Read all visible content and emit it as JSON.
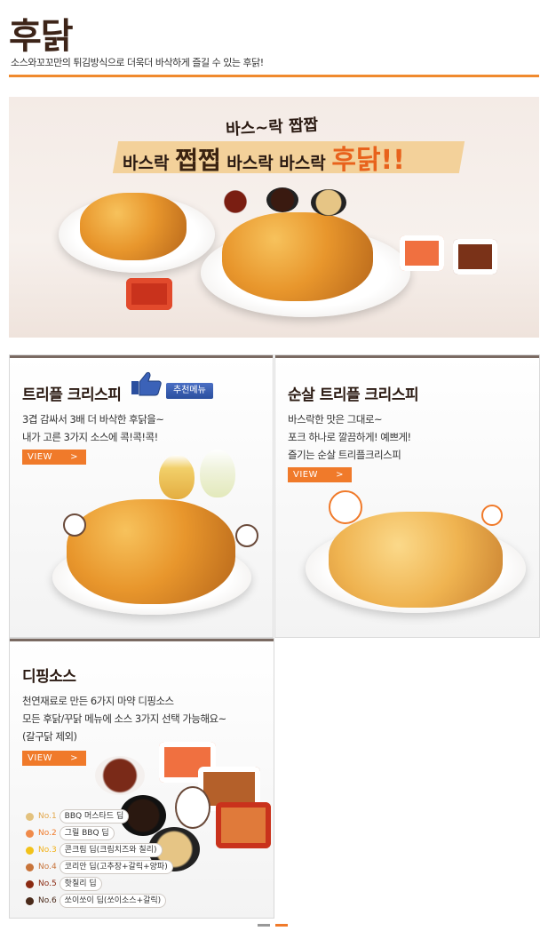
{
  "header": {
    "title": "후닭",
    "subtitle": "소스와꼬꼬만의 튀김방식으로 더욱더 바삭하게 즐길 수 있는 후닭!"
  },
  "banner": {
    "line_top": "바스~락 짭짭",
    "line_main_1": "바스락",
    "line_main_em1": "쩝쩝",
    "line_main_2": "바스락 바스락",
    "line_main_em2": "후닭!!"
  },
  "cards": {
    "triple": {
      "title": "트리플 크리스피",
      "badge": "추천메뉴",
      "desc1": "3겹 감싸서 3배 더 바삭한 후닭을~",
      "desc2": "내가 고른 3가지 소스에 콕!콕!콕!",
      "view_label": "VIEW",
      "view_arrow": ">"
    },
    "boneless": {
      "title": "순살 트리플 크리스피",
      "desc1": "바스락한 맛은 그대로~",
      "desc2": "포크 하나로 깔끔하게! 예쁘게!",
      "desc3": "즐기는 순살 트리플크리스피",
      "view_label": "VIEW",
      "view_arrow": ">"
    },
    "dipping": {
      "title": "디핑소스",
      "desc1": "천연재료로 만든 6가지 마약 디핑소스",
      "desc2": "모든 후닭/꾸닭 메뉴에 소스 3가지 선택 가능해요~",
      "desc3": "(갈구닭 제외)",
      "view_label": "VIEW",
      "view_arrow": ">",
      "sauces": [
        {
          "num": "No.1",
          "name": "BBQ 머스타드 딥",
          "color": "#e3c27e",
          "num_color": "#e3a84c"
        },
        {
          "num": "No.2",
          "name": "그릴 BBQ 딥",
          "color": "#f08a4a",
          "num_color": "#f07a2a"
        },
        {
          "num": "No.3",
          "name": "콘크림 딥(크림치즈와 칠리)",
          "color": "#f2c21a",
          "num_color": "#f2b21a"
        },
        {
          "num": "No.4",
          "name": "코리안 딥(고추장+갈릭+양파)",
          "color": "#c8743a",
          "num_color": "#c8743a"
        },
        {
          "num": "No.5",
          "name": "핫칠리 딥",
          "color": "#8a2a12",
          "num_color": "#8a2a12"
        },
        {
          "num": "No.6",
          "name": "쏘이쏘이 딥(쏘이소스+갈릭)",
          "color": "#4a2a1a",
          "num_color": "#4a2a1a"
        }
      ]
    }
  },
  "colors": {
    "accent": "#f07a2a",
    "title": "#3d2418",
    "badge_blue": "#2b4f9e"
  },
  "icons": {
    "thumbs_up": "thumbs-up-icon",
    "view_arrow": "chevron-right-icon"
  }
}
